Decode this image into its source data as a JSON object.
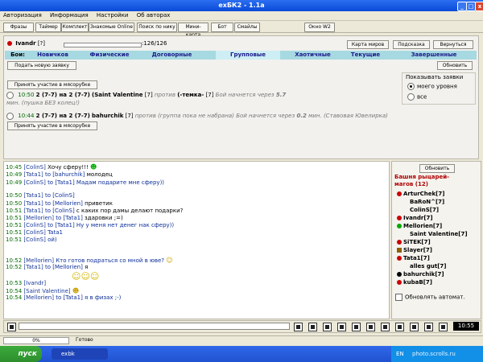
{
  "window": {
    "title": "exБК2 - 1.1a"
  },
  "menu": [
    "Авторизация",
    "Информация",
    "Настройки",
    "Об авторах"
  ],
  "toolbar": {
    "buttons": [
      "Фразы",
      "Таймер",
      "Комплект",
      "Знакомые Online",
      "Поиск по нику",
      "Мини-карта",
      "Бот",
      "Смайлы"
    ],
    "window2": "Окно W2"
  },
  "player": {
    "nick": "Ivandr",
    "level": "[?]",
    "hp": ":126/126"
  },
  "top_buttons": {
    "map": "Карта миров",
    "hint": "Подсказка",
    "back": "Вернуться",
    "refresh": "Обновить"
  },
  "fights": {
    "label": "Бои:",
    "tabs": [
      "Новичков",
      "Физические",
      "Договорные",
      "Групповые",
      "Хаотичные",
      "Текущие",
      "Завершенные"
    ],
    "new_request": "Подать новую заявку",
    "join_meat": "Принять участие в мясорубке",
    "show_label": "Показывать заявки",
    "options": [
      "моего уровня",
      "все"
    ],
    "requests": [
      {
        "time": "10:50",
        "text_a": "2 (7-7) на 2 (7-7)",
        "fighter": "(Saint Valentine",
        "flvl": "[7]",
        "vs": "против",
        "opp": "(-темка-",
        "olvl": "[7]",
        "note": "Бой начнется через",
        "mins": "5.7",
        "unit": "мин. (пушка БЕЗ колец!)"
      },
      {
        "time": "10:44",
        "text_a": "2 (7-7) на 2 (7-7)",
        "fighter": "bahurchik",
        "flvl": "[7]",
        "vs": "против",
        "opp": "(группа пока не набрана)",
        "note": "Бой начнется через",
        "mins": "0.2",
        "unit": "мин. (Ставовая Ювелирка)"
      }
    ]
  },
  "chat": [
    {
      "time": "10:45",
      "who": "[ColinS]",
      "to": "",
      "msg": "Хочу сферу!!!"
    },
    {
      "time": "10:49",
      "who": "[Tata1]",
      "to": "to [bahurchik]",
      "msg": "молодец"
    },
    {
      "time": "10:49",
      "who": "[ColinS]",
      "to": "to [Tata1]",
      "msg": "Мадам подарите мне сферу))"
    },
    {
      "time": "10:50",
      "who": "[Tata1]",
      "to": "to [ColinS]",
      "msg": ""
    },
    {
      "time": "10:50",
      "who": "[Tata1]",
      "to": "to [Mellorien]",
      "msg": "приветик"
    },
    {
      "time": "10:51",
      "who": "[Tata1]",
      "to": "to [ColinS]",
      "msg": "с каких пор дамы делают подарки?"
    },
    {
      "time": "10:51",
      "who": "[Mellorien]",
      "to": "to [Tata1]",
      "msg": "здаровки ;=)"
    },
    {
      "time": "10:51",
      "who": "[ColinS]",
      "to": "to [Tata1]",
      "msg": "Ну у меня нет денег нак сферу))"
    },
    {
      "time": "10:51",
      "who": "[ColinS]",
      "to": "",
      "msg": "Tata1"
    },
    {
      "time": "10:51",
      "who": "[ColinS]",
      "to": "",
      "msg": "ой)"
    },
    {
      "time": "10:52",
      "who": "[Mellorien]",
      "to": "",
      "msg": "Кто готов подраться со мной в юве?"
    },
    {
      "time": "10:52",
      "who": "[Tata1]",
      "to": "to [Mellorien]",
      "msg": "я"
    },
    {
      "time": "10:53",
      "who": "[Ivandr]",
      "to": "",
      "msg": ""
    },
    {
      "time": "10:54",
      "who": "[Saint Valentine]",
      "to": "",
      "msg": ""
    },
    {
      "time": "10:54",
      "who": "[Mellorien]",
      "to": "to [Tata1]",
      "msg": "я в физах ;-)"
    }
  ],
  "sidebar": {
    "refresh": "Обновить",
    "location": "Башня рыцарей-магов (12)",
    "players": [
      "ArturChek[7]",
      "BaRoN^[7]",
      "ColinS[7]",
      "Ivandr[7]",
      "Mellorien[7]",
      "Saint Valentine[7]",
      "SiTEK[7]",
      "Slayer[7]",
      "Tata1[7]",
      "alles gut[7]",
      "bahurchik[7]",
      "kubaB[7]"
    ],
    "auto_refresh": "Обновлять автомат."
  },
  "clock": "10:55",
  "status": {
    "progress": "0%",
    "ready": "Готово"
  },
  "taskbar": {
    "start": "пуск",
    "task": "exbk",
    "lang": "EN",
    "watermark": "photo.scrolls.ru"
  },
  "colors": {
    "titlebar": "#0a4ad8",
    "tabs_bg": "#a7d9e2",
    "time_green": "#006a00",
    "nick_blue": "#1a3a9a"
  }
}
